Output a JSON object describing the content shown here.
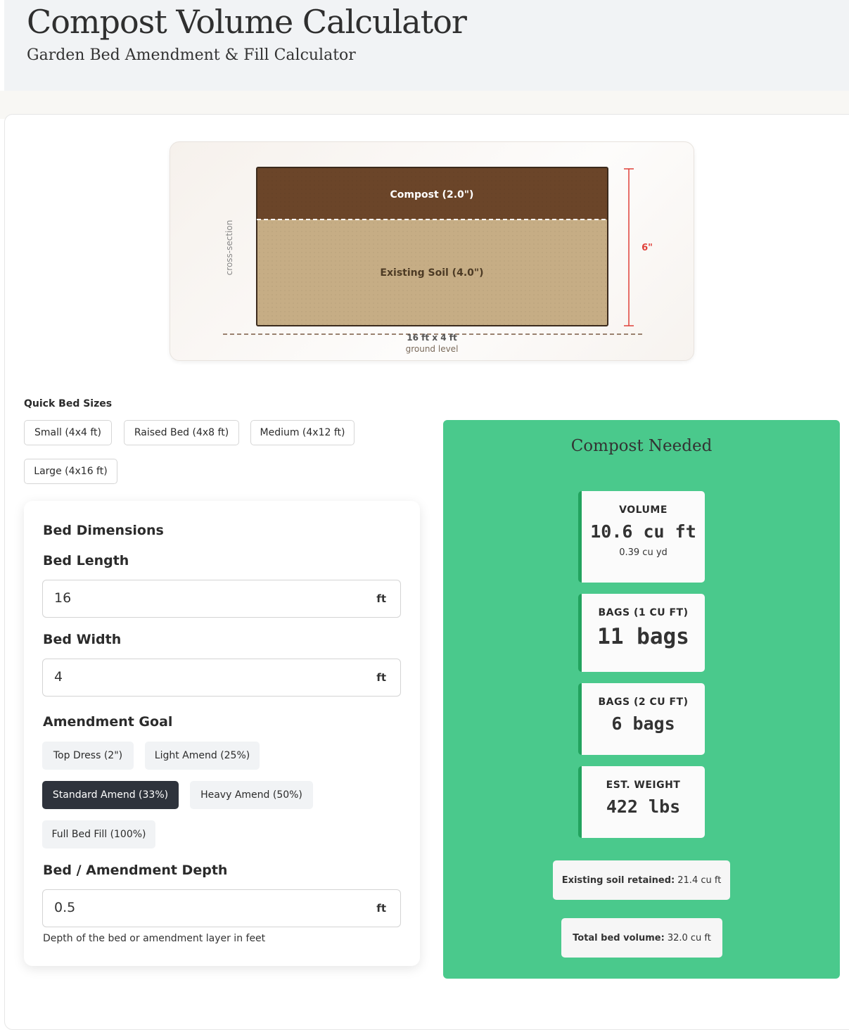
{
  "header": {
    "title": "Compost Volume Calculator",
    "subtitle": "Garden Bed Amendment & Fill Calculator"
  },
  "diagram": {
    "compost_label": "Compost (2.0\")",
    "soil_label": "Existing Soil (4.0\")",
    "depth_label": "6\"",
    "side_label": "cross-section",
    "size_label": "16 ft x 4 ft",
    "ground_label": "ground level",
    "compost_inches": 2.0,
    "soil_inches": 4.0,
    "colors": {
      "compost": "#6b4529",
      "soil": "#c6ad85",
      "depth_marker": "#e0413a"
    }
  },
  "quick_sizes": {
    "label": "Quick Bed Sizes",
    "items": [
      "Small (4x4 ft)",
      "Raised Bed (4x8 ft)",
      "Medium (4x12 ft)",
      "Large (4x16 ft)"
    ]
  },
  "form": {
    "section_title": "Bed Dimensions",
    "length": {
      "label": "Bed Length",
      "value": "16",
      "unit": "ft"
    },
    "width": {
      "label": "Bed Width",
      "value": "4",
      "unit": "ft"
    },
    "goal": {
      "label": "Amendment Goal",
      "options": [
        "Top Dress (2\")",
        "Light Amend (25%)",
        "Standard Amend (33%)",
        "Heavy Amend (50%)",
        "Full Bed Fill (100%)"
      ],
      "selected": "Standard Amend (33%)"
    },
    "depth": {
      "label": "Bed / Amendment Depth",
      "value": "0.5",
      "unit": "ft",
      "hint": "Depth of the bed or amendment layer in feet"
    }
  },
  "results": {
    "title": "Compost Needed",
    "volume": {
      "label": "VOLUME",
      "value": "10.6 cu ft",
      "sub": "0.39 cu yd"
    },
    "bags1": {
      "label": "BAGS (1 CU FT)",
      "value": "11 bags"
    },
    "bags2": {
      "label": "BAGS (2 CU FT)",
      "value": "6 bags"
    },
    "weight": {
      "label": "EST. WEIGHT",
      "value": "422 lbs"
    },
    "retained": {
      "label": "Existing soil retained:",
      "value": "21.4 cu ft"
    },
    "total": {
      "label": "Total bed volume:",
      "value": "32.0 cu ft"
    },
    "colors": {
      "panel": "#4ac98c",
      "accent": "#22a35e"
    }
  }
}
